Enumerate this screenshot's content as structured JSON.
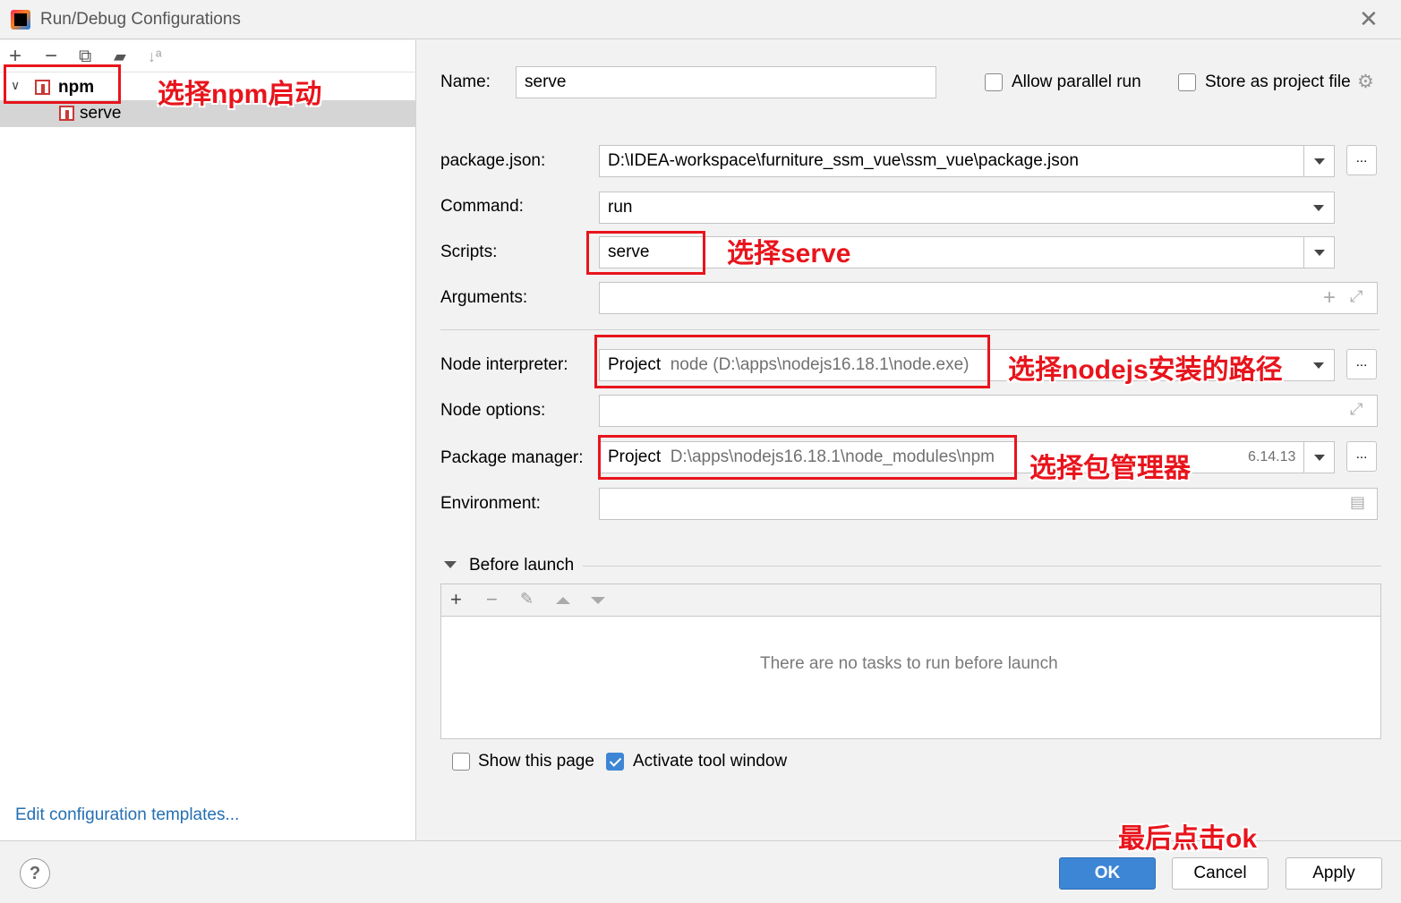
{
  "window": {
    "title": "Run/Debug Configurations"
  },
  "toolbar": {
    "add": "+",
    "remove": "−",
    "copy": "⧉",
    "folder": "▰",
    "sort": "↓ª"
  },
  "tree": {
    "group_label": "npm",
    "child_label": "serve"
  },
  "edit_templates": "Edit configuration templates...",
  "form": {
    "name_label": "Name:",
    "name_value": "serve",
    "allow_parallel": "Allow parallel run",
    "store_project": "Store as project file",
    "package_json_label": "package.json:",
    "package_json_value": "D:\\IDEA-workspace\\furniture_ssm_vue\\ssm_vue\\package.json",
    "command_label": "Command:",
    "command_value": "run",
    "scripts_label": "Scripts:",
    "scripts_value": "serve",
    "arguments_label": "Arguments:",
    "node_interp_label": "Node interpreter:",
    "node_interp_project": "Project",
    "node_interp_path": "node (D:\\apps\\nodejs16.18.1\\node.exe)",
    "node_options_label": "Node options:",
    "pkg_mgr_label": "Package manager:",
    "pkg_mgr_project": "Project",
    "pkg_mgr_path": "D:\\apps\\nodejs16.18.1\\node_modules\\npm",
    "pkg_mgr_version": "6.14.13",
    "environment_label": "Environment:",
    "dots": "...",
    "before_launch": "Before launch",
    "no_tasks": "There are no tasks to run before launch",
    "show_page": "Show this page",
    "activate_tool": "Activate tool window"
  },
  "checkboxes": {
    "allow_parallel": false,
    "store_project": false,
    "show_page": false,
    "activate_tool": true
  },
  "buttons": {
    "ok": "OK",
    "cancel": "Cancel",
    "apply": "Apply",
    "help": "?"
  },
  "annotations": {
    "npm": "选择npm启动",
    "serve": "选择serve",
    "node": "选择nodejs安装的路径",
    "pkg": "选择包管理器",
    "ok": "最后点击ok"
  },
  "colors": {
    "accent": "#3d86d6",
    "annotation": "#e8141c",
    "link": "#2470b3"
  }
}
